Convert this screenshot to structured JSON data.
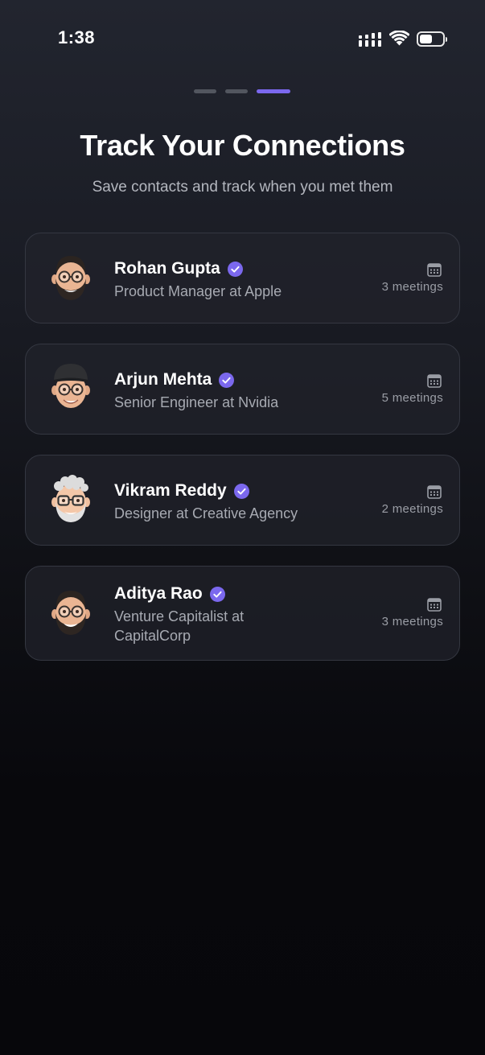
{
  "status_bar": {
    "time": "1:38"
  },
  "onboarding": {
    "pages": 3,
    "active_page": 3,
    "accent_color": "#7b68ee",
    "title": "Track Your Connections",
    "subtitle": "Save contacts and track when you met them"
  },
  "contacts": [
    {
      "name": "Rohan Gupta",
      "role": "Product Manager at Apple",
      "meetings": "3 meetings",
      "verified": true,
      "avatar_icon": "memoji-beard-glasses-icon"
    },
    {
      "name": "Arjun Mehta",
      "role": "Senior Engineer at Nvidia",
      "meetings": "5 meetings",
      "verified": true,
      "avatar_icon": "memoji-cap-glasses-icon"
    },
    {
      "name": "Vikram Reddy",
      "role": "Designer at Creative Agency",
      "meetings": "2 meetings",
      "verified": true,
      "avatar_icon": "memoji-grey-hair-glasses-icon"
    },
    {
      "name": "Aditya Rao",
      "role": "Venture Capitalist at CapitalCorp",
      "meetings": "3 meetings",
      "verified": true,
      "avatar_icon": "memoji-beard-glasses-icon"
    }
  ]
}
